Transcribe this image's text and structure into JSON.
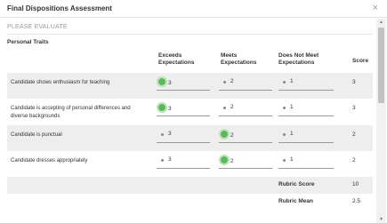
{
  "dialog": {
    "title": "Final Dispositions Assessment",
    "close_glyph": "×"
  },
  "section": {
    "label": "PLEASE EVALUATE",
    "group_heading": "Personal Traits"
  },
  "table": {
    "headers": {
      "exceeds": "Exceeds\nExpectations",
      "meets": "Meets\nExpectations",
      "not_meet": "Does Not Meet\nExpectations",
      "score": "Score"
    },
    "rows": [
      {
        "trait": "Candidate shows enthusiasm for teaching",
        "options": [
          "3",
          "2",
          "1"
        ],
        "selected": "3",
        "score": "3"
      },
      {
        "trait": "Candidate is accepting of personal differences and diverse backgrounds",
        "options": [
          "3",
          "2",
          "1"
        ],
        "selected": "3",
        "score": "3"
      },
      {
        "trait": "Candidate is punctual",
        "options": [
          "3",
          "2",
          "1"
        ],
        "selected": "2",
        "score": "2"
      },
      {
        "trait": "Candidate dresses appropriately",
        "options": [
          "3",
          "2",
          "1"
        ],
        "selected": "2",
        "score": "2"
      }
    ],
    "summary": {
      "rubric_score_label": "Rubric Score",
      "rubric_score_value": "10",
      "rubric_mean_label": "Rubric Mean",
      "rubric_mean_value": "2.5"
    }
  },
  "colors": {
    "selected_radio": "#5cb85c",
    "row_shade": "#eeeeee"
  }
}
